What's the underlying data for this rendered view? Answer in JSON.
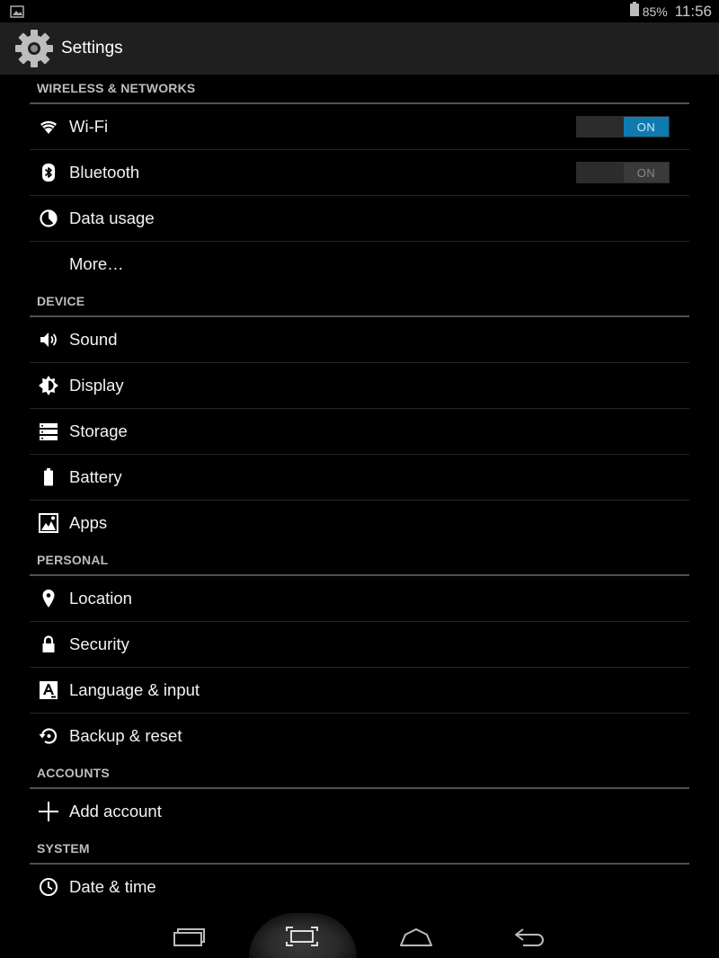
{
  "status": {
    "battery_percent": "85%",
    "time": "11:56",
    "left_icon": "image-notification-icon"
  },
  "actionbar": {
    "title": "Settings",
    "icon": "gear-icon"
  },
  "colors": {
    "toggle_on": "#0e7bb0",
    "section_divider": "#505050",
    "actionbar_bg": "#1f1f1f"
  },
  "sections": {
    "wireless": {
      "header": "WIRELESS & NETWORKS",
      "items": [
        {
          "label": "Wi-Fi",
          "icon": "wifi-icon",
          "toggle": "ON",
          "toggle_state": "on"
        },
        {
          "label": "Bluetooth",
          "icon": "bluetooth-icon",
          "toggle": "ON",
          "toggle_state": "off"
        },
        {
          "label": "Data usage",
          "icon": "data-usage-icon"
        },
        {
          "label": "More…"
        }
      ]
    },
    "device": {
      "header": "DEVICE",
      "items": [
        {
          "label": "Sound",
          "icon": "speaker-icon"
        },
        {
          "label": "Display",
          "icon": "brightness-icon"
        },
        {
          "label": "Storage",
          "icon": "storage-icon"
        },
        {
          "label": "Battery",
          "icon": "battery-icon"
        },
        {
          "label": "Apps",
          "icon": "apps-icon"
        }
      ]
    },
    "personal": {
      "header": "PERSONAL",
      "items": [
        {
          "label": "Location",
          "icon": "location-pin-icon"
        },
        {
          "label": "Security",
          "icon": "lock-icon"
        },
        {
          "label": "Language & input",
          "icon": "language-icon"
        },
        {
          "label": "Backup & reset",
          "icon": "backup-icon"
        }
      ]
    },
    "accounts": {
      "header": "ACCOUNTS",
      "items": [
        {
          "label": "Add account",
          "icon": "plus-icon"
        }
      ]
    },
    "system": {
      "header": "SYSTEM",
      "items": [
        {
          "label": "Date & time",
          "icon": "clock-icon"
        }
      ]
    }
  },
  "navbar": {
    "buttons": [
      "recent-apps-icon",
      "screenshot-icon",
      "home-icon",
      "back-icon"
    ]
  }
}
